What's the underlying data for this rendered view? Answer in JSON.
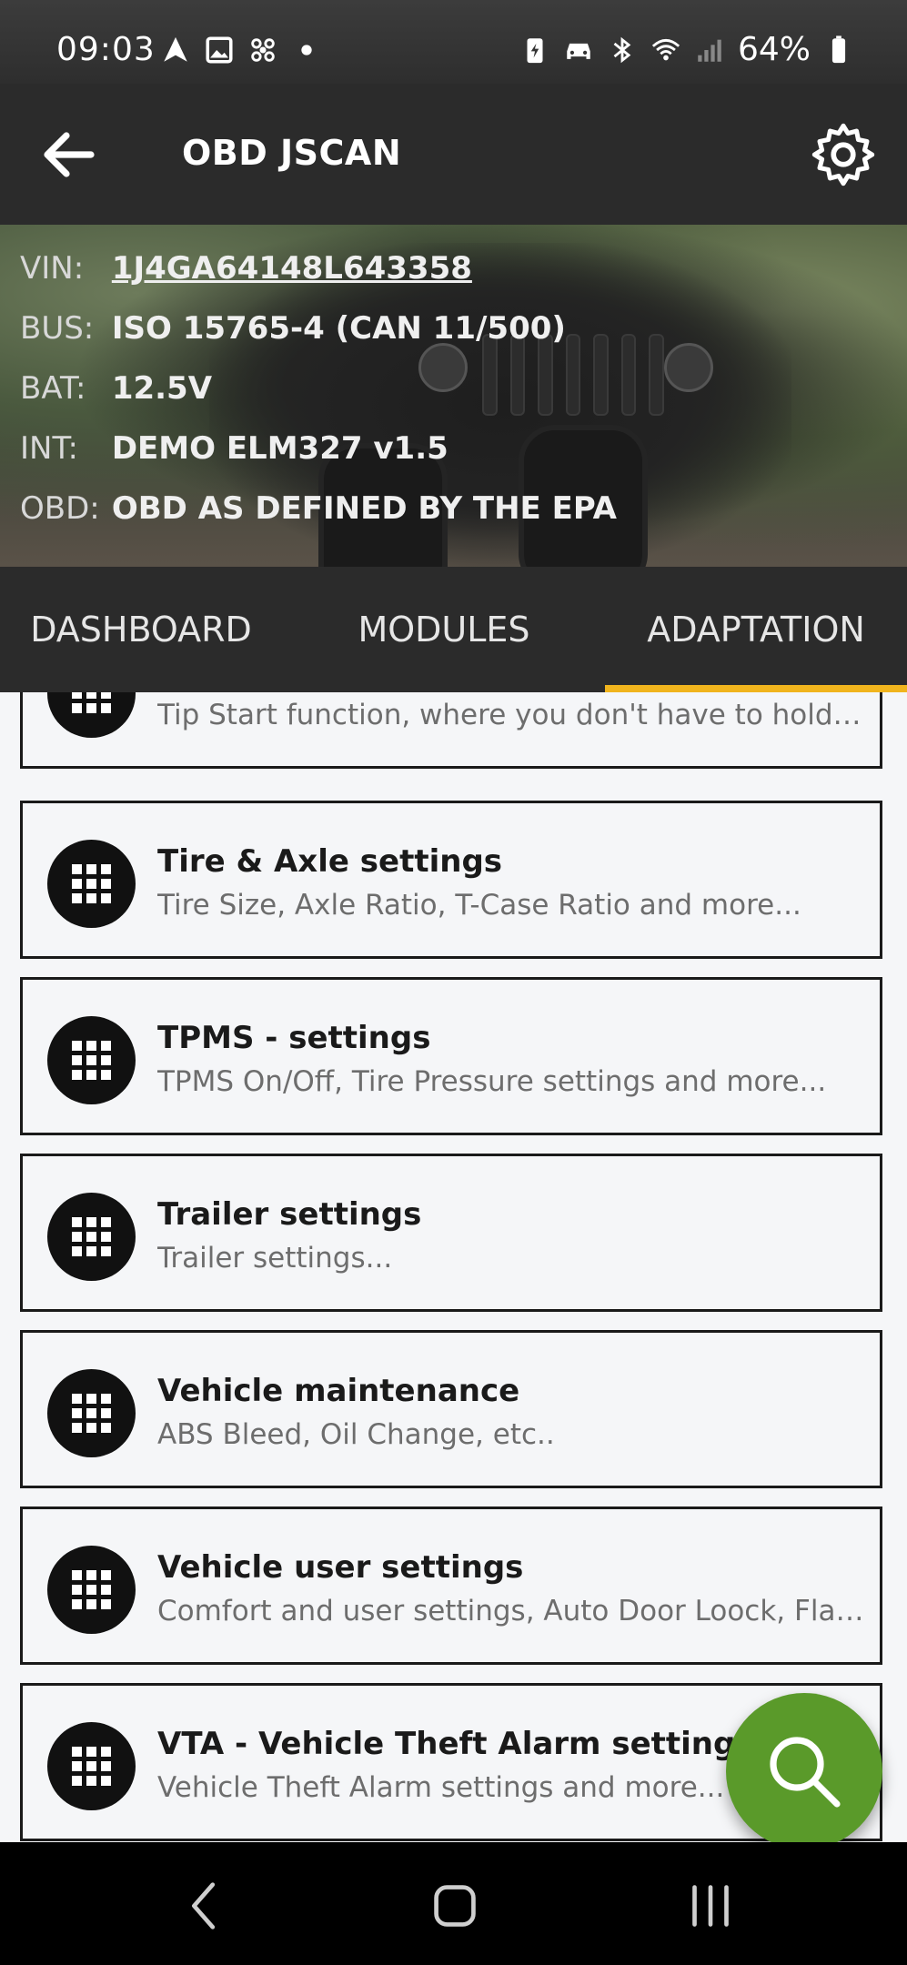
{
  "status_bar": {
    "time": "09:03",
    "battery_percent": "64%",
    "left_icons": [
      "navigation-arrow-icon",
      "image-icon",
      "fan-icon",
      "dot-icon"
    ],
    "right_icons": [
      "battery-saver-icon",
      "car-icon",
      "bluetooth-icon",
      "wifi-icon",
      "signal-icon",
      "battery-icon"
    ]
  },
  "app_bar": {
    "title": "OBD JSCAN"
  },
  "vehicle": {
    "vin_label": "VIN:",
    "vin_value": "1J4GA64148L643358",
    "bus_label": "BUS:",
    "bus_value": "ISO 15765-4 (CAN 11/500)",
    "bat_label": "BAT:",
    "bat_value": "12.5V",
    "int_label": "INT:",
    "int_value": "DEMO ELM327 v1.5",
    "obd_label": "OBD:",
    "obd_value": "OBD AS DEFINED BY THE EPA"
  },
  "tabs": [
    {
      "label": "DASHBOARD",
      "active": false
    },
    {
      "label": "MODULES",
      "active": false
    },
    {
      "label": "ADAPTATION",
      "active": true
    }
  ],
  "list_items": [
    {
      "title": "",
      "subtitle": "Tip Start function, where you don't have to hold t..."
    },
    {
      "title": "Tire & Axle settings",
      "subtitle": "Tire Size, Axle Ratio, T-Case Ratio and more..."
    },
    {
      "title": "TPMS - settings",
      "subtitle": "TPMS On/Off, Tire Pressure settings and more..."
    },
    {
      "title": "Trailer settings",
      "subtitle": "Trailer settings..."
    },
    {
      "title": "Vehicle maintenance",
      "subtitle": "ABS Bleed, Oil Change, etc.."
    },
    {
      "title": "Vehicle user settings",
      "subtitle": "Comfort and user settings, Auto Door Loock, Flas..."
    },
    {
      "title": "VTA - Vehicle Theft Alarm settings",
      "subtitle": "Vehicle Theft Alarm settings and more..."
    }
  ],
  "colors": {
    "accent": "#f0b41d",
    "fab": "#5a9a2a",
    "bar": "#2b2b2b"
  }
}
